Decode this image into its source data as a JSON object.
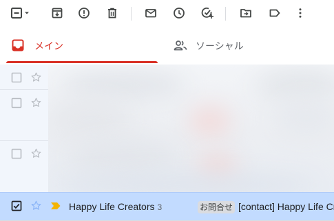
{
  "toolbar": {
    "buttons": [
      {
        "name": "select-all-checkbox",
        "icon": "minus-checkbox-icon"
      },
      {
        "name": "archive-button",
        "icon": "archive-icon"
      },
      {
        "name": "report-spam-button",
        "icon": "report-icon"
      },
      {
        "name": "delete-button",
        "icon": "trash-icon"
      },
      {
        "name": "mark-unread-button",
        "icon": "envelope-icon"
      },
      {
        "name": "snooze-button",
        "icon": "clock-icon"
      },
      {
        "name": "add-to-tasks-button",
        "icon": "task-add-icon"
      },
      {
        "name": "move-to-button",
        "icon": "folder-move-icon"
      },
      {
        "name": "label-button",
        "icon": "label-icon"
      },
      {
        "name": "more-button",
        "icon": "more-vertical-icon"
      }
    ]
  },
  "tabs": [
    {
      "label": "メイン",
      "icon": "inbox-icon",
      "active": true,
      "color": "#d93025"
    },
    {
      "label": "ソーシャル",
      "icon": "people-icon",
      "active": false,
      "color": "#5f6368"
    }
  ],
  "selected_message": {
    "sender": "Happy Life Creators",
    "count": "3",
    "label": "お問合せ",
    "subject": "[contact] Happy Life Cre",
    "checked": true,
    "starred": false,
    "important_marker_color": "#f4b400",
    "row_color": "#c2dbff"
  }
}
